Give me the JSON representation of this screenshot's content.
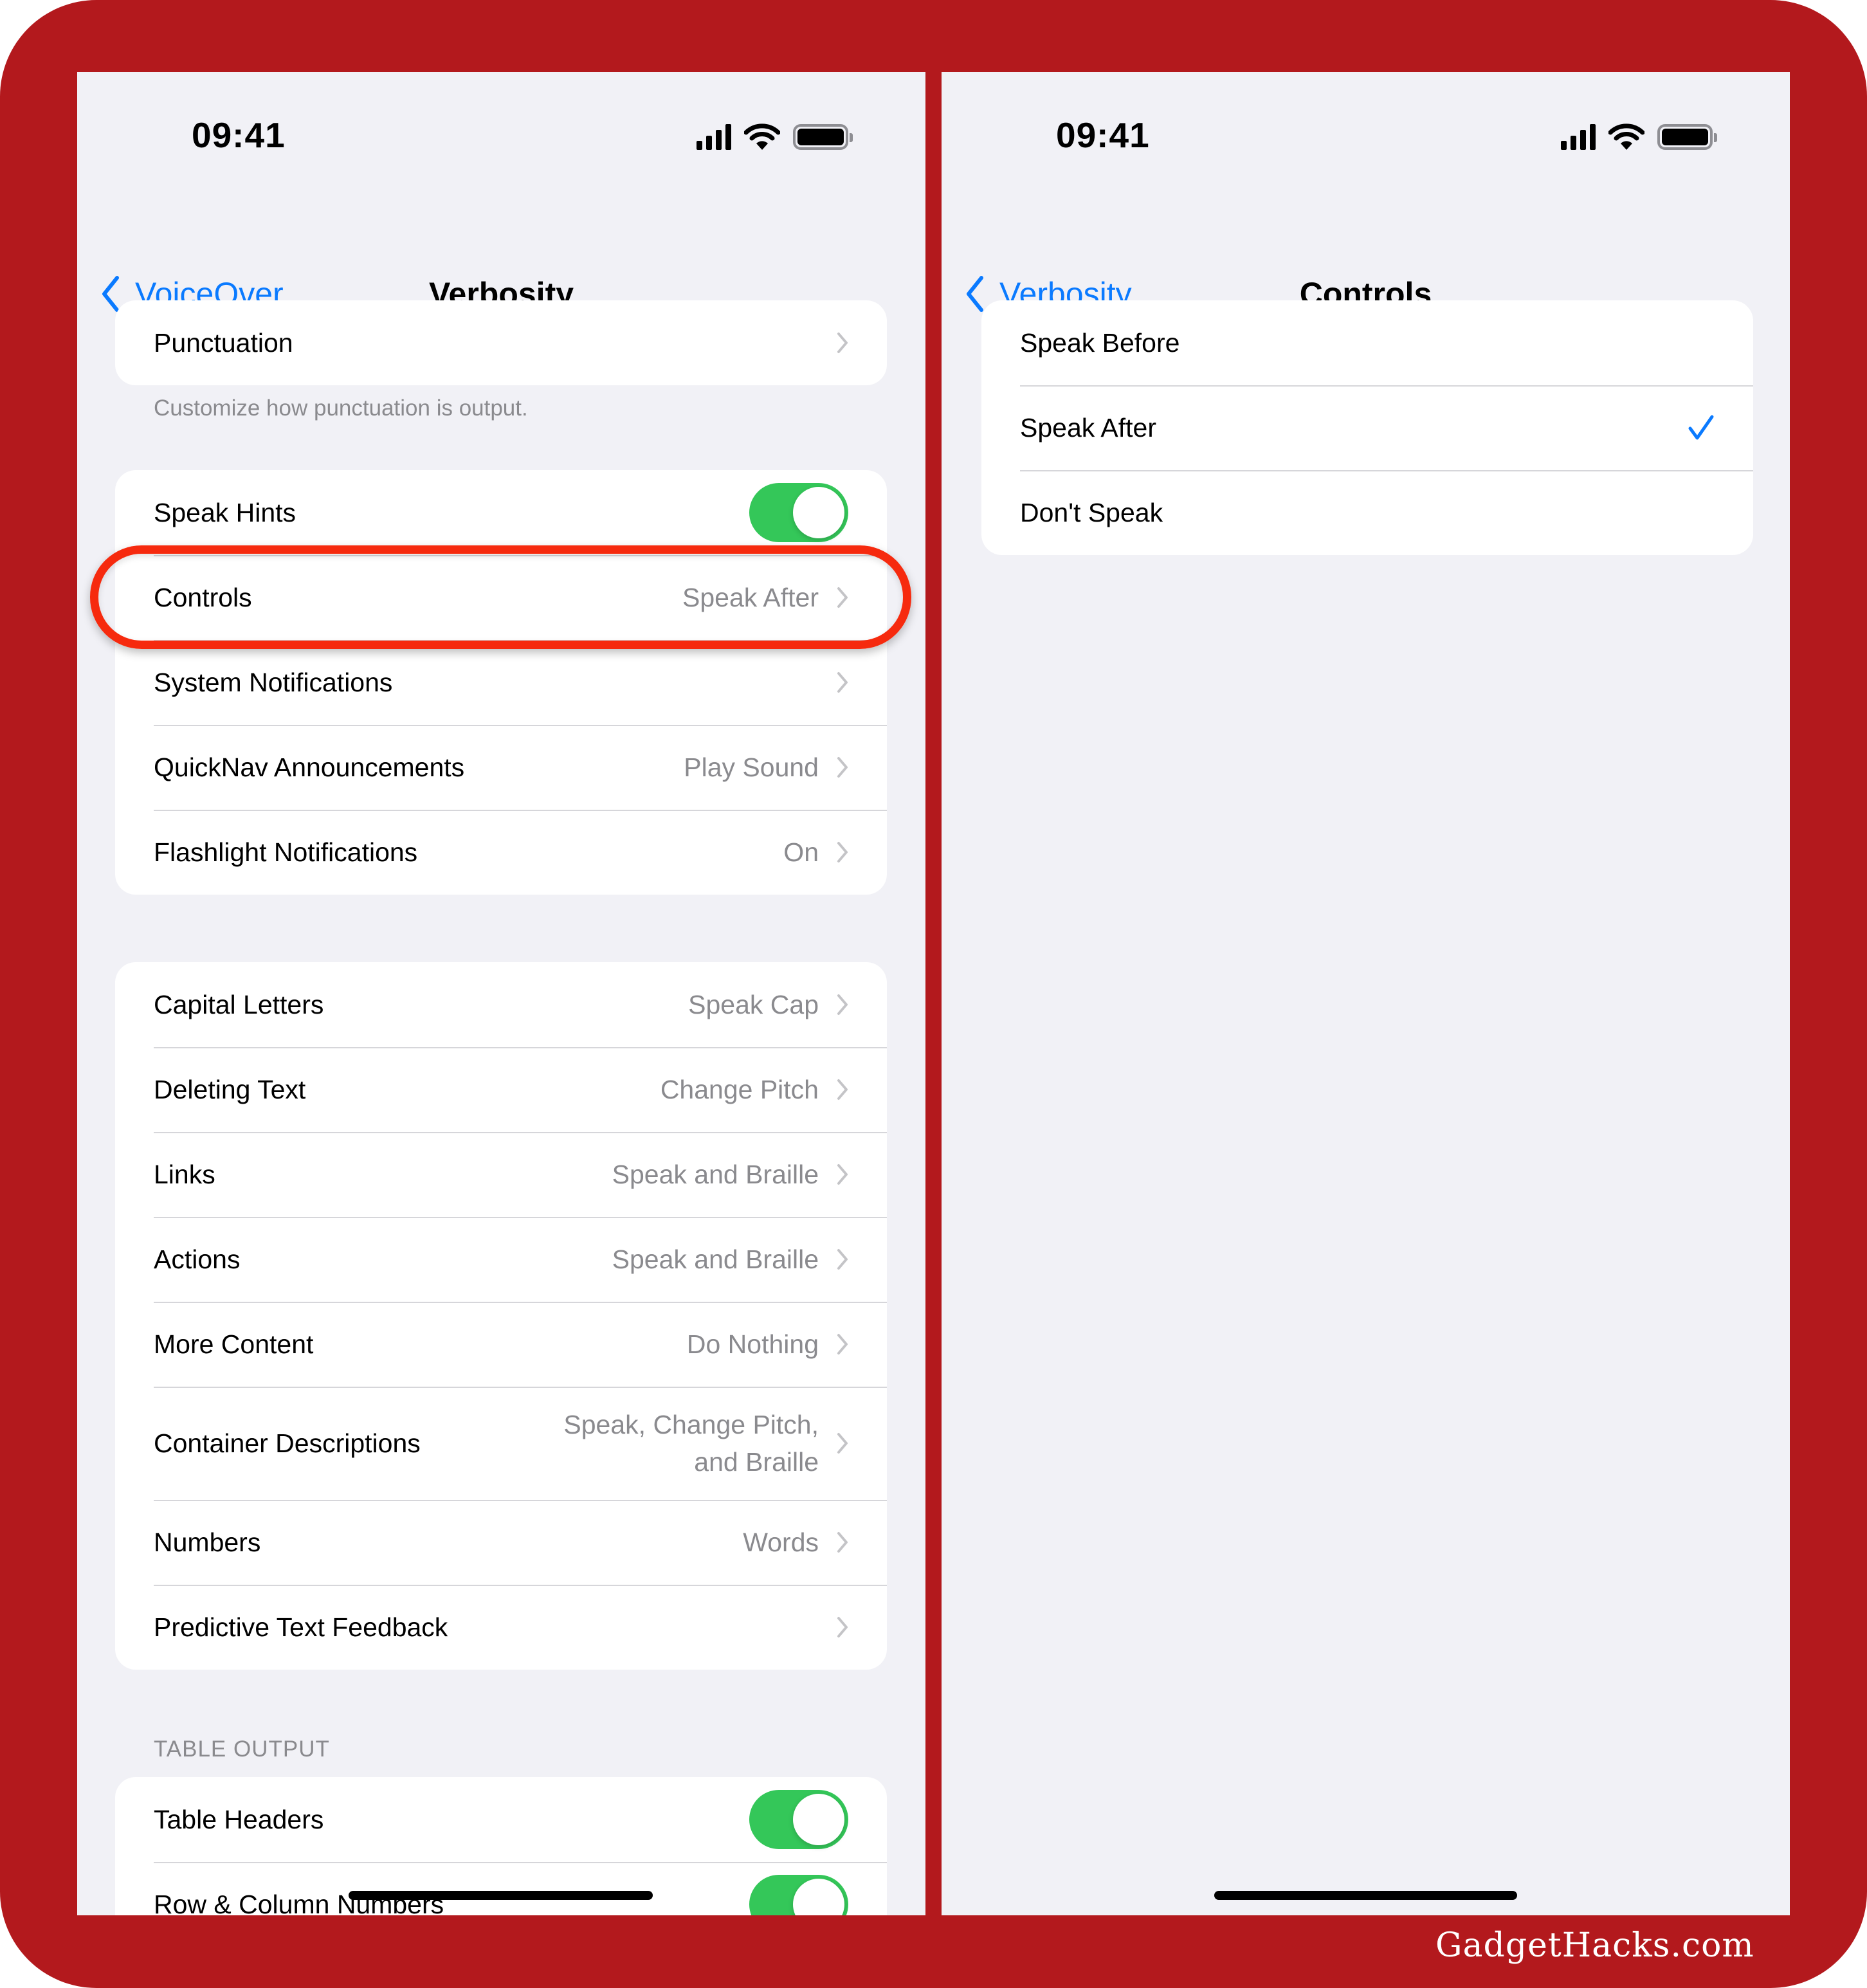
{
  "left_screen": {
    "status_bar": {
      "time": "09:41",
      "icons": [
        "cellular-signal-icon",
        "wifi-icon",
        "battery-icon"
      ]
    },
    "nav": {
      "back_label": "VoiceOver",
      "title": "Verbosity"
    },
    "group_punctuation": {
      "rows": [
        {
          "label": "Punctuation",
          "value": ""
        }
      ],
      "footer": "Customize how punctuation is output."
    },
    "group_hints": {
      "speak_hints": {
        "label": "Speak Hints",
        "toggle_on": true
      },
      "rows": [
        {
          "label": "Controls",
          "value": "Speak After"
        },
        {
          "label": "System Notifications",
          "value": ""
        },
        {
          "label": "QuickNav Announcements",
          "value": "Play Sound"
        },
        {
          "label": "Flashlight Notifications",
          "value": "On"
        }
      ]
    },
    "group_text": {
      "rows": [
        {
          "label": "Capital Letters",
          "value": "Speak Cap"
        },
        {
          "label": "Deleting Text",
          "value": "Change Pitch"
        },
        {
          "label": "Links",
          "value": "Speak and Braille"
        },
        {
          "label": "Actions",
          "value": "Speak and Braille"
        },
        {
          "label": "More Content",
          "value": "Do Nothing"
        },
        {
          "label": "Container Descriptions",
          "value_line1": "Speak, Change Pitch,",
          "value_line2": "and Braille"
        },
        {
          "label": "Numbers",
          "value": "Words"
        },
        {
          "label": "Predictive Text Feedback",
          "value": ""
        }
      ]
    },
    "group_table": {
      "header": "TABLE OUTPUT",
      "rows": [
        {
          "label": "Table Headers",
          "toggle_on": true
        },
        {
          "label": "Row & Column Numbers",
          "toggle_on": true
        }
      ]
    }
  },
  "right_screen": {
    "status_bar": {
      "time": "09:41",
      "icons": [
        "cellular-signal-icon",
        "wifi-icon",
        "battery-icon"
      ]
    },
    "nav": {
      "back_label": "Verbosity",
      "title": "Controls"
    },
    "options": [
      {
        "label": "Speak Before",
        "selected": false
      },
      {
        "label": "Speak After",
        "selected": true
      },
      {
        "label": "Don't Speak",
        "selected": false
      }
    ]
  },
  "colors": {
    "frame": "#b3191d",
    "accent_blue": "#0a7aff",
    "toggle_green": "#34c759",
    "highlight_red": "#f62a0e",
    "background": "#f1f1f6"
  },
  "watermark": "GadgetHacks.com"
}
